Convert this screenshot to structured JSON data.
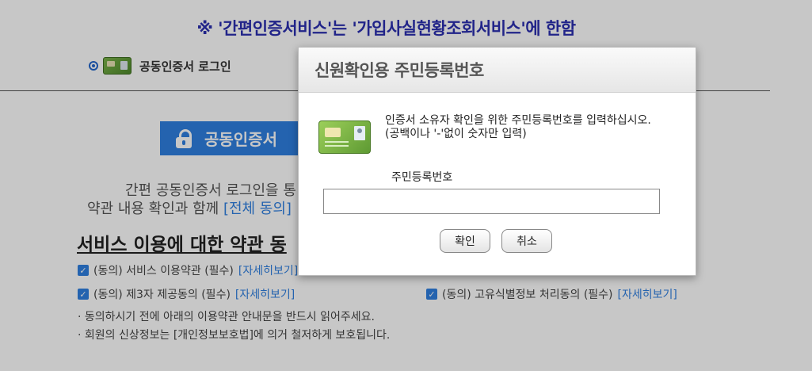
{
  "notice": "※ '간편인증서비스'는 '가입사실현황조회서비스'에 한함",
  "login_option": {
    "label": "공동인증서 로그인",
    "icon": "certificate-card-icon"
  },
  "cert_button": {
    "label": "공동인증서",
    "icon": "lock-icon"
  },
  "description": {
    "line1": "간편 공동인증서 로그인을 통",
    "line2_prefix": "약관 내용 확인과 함께 ",
    "line2_link": "[전체 동의]"
  },
  "terms": {
    "title": "서비스 이용에 대한 약관 동",
    "items": [
      {
        "text": "(동의) 서비스 이용약관 (필수) ",
        "link": "[자세히보기]"
      },
      {
        "text": "(동의) 제3자 제공동의 (필수) ",
        "link": "[자세히보기]"
      },
      {
        "text": "(동의) 고유식별정보 처리동의 (필수) ",
        "link": "[자세히보기]"
      }
    ],
    "bullets": [
      "· 동의하시기 전에 아래의 이용약관 안내문을 반드시 읽어주세요.",
      "· 회원의 신상정보는 [개인정보보호법]에 의거 철저하게 보호됩니다."
    ]
  },
  "dialog": {
    "title": "신원확인용 주민등록번호",
    "message_line1": "인증서 소유자 확인을 위한 주민등록번호를 입력하십시오.",
    "message_line2": "(공백이나 '-'없이 숫자만 입력)",
    "field_label": "주민등록번호",
    "input_value": "",
    "ok_label": "확인",
    "cancel_label": "취소"
  },
  "colors": {
    "accent": "#2f7fe0",
    "notice": "#2b2fb0"
  }
}
